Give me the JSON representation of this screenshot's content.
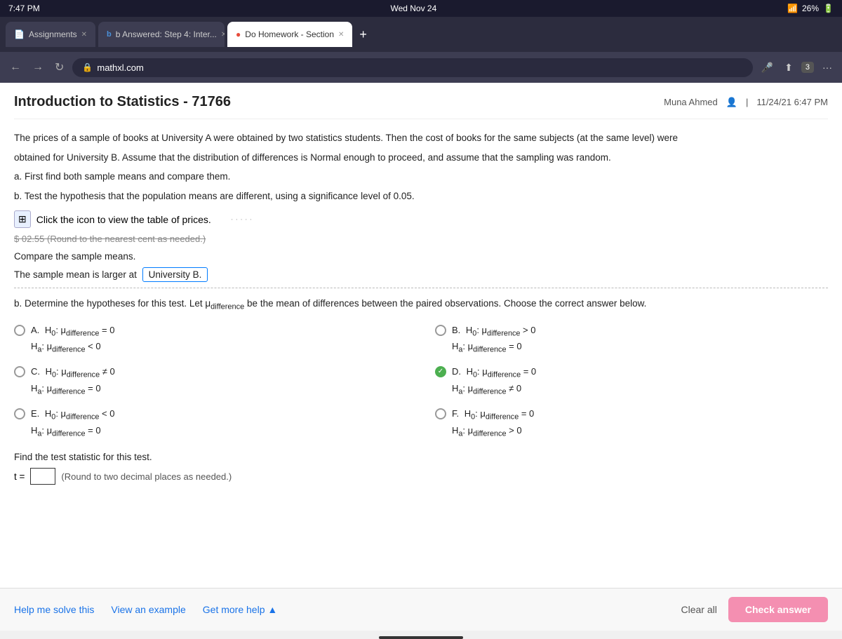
{
  "status_bar": {
    "time": "7:47 PM",
    "day": "Wed Nov 24",
    "battery": "26%",
    "wifi": "WiFi"
  },
  "browser": {
    "tabs": [
      {
        "id": "assignments",
        "label": "Assignments",
        "active": false,
        "icon": "doc"
      },
      {
        "id": "answered",
        "label": "b Answered: Step 4: Inter...",
        "active": false,
        "icon": "b"
      },
      {
        "id": "homework",
        "label": "Do Homework - Section",
        "active": true,
        "icon": "circle"
      }
    ],
    "url": "mathxl.com",
    "back": "←",
    "forward": "→",
    "refresh": "↻",
    "badge_count": "3"
  },
  "page": {
    "course_title": "Introduction to Statistics - 71766",
    "user": "Muna Ahmed",
    "date_time": "11/24/21 6:47 PM",
    "problem_text": [
      "The prices of a sample of books at University A were obtained by two statistics students. Then the cost of books for the same subjects (at the same level) were",
      "obtained for University B. Assume that the distribution of differences is Normal enough to proceed, and assume that the sampling was random.",
      "a. First find both sample means and compare them.",
      "b. Test the hypothesis that the population means are different, using a significance level of 0.05."
    ],
    "table_icon_label": "Click the icon to view the table of prices.",
    "strikethrough": "$ 02.55  (Round to the nearest cent as needed.)",
    "compare_label": "Compare the sample means.",
    "sample_mean_text": "The sample mean is larger at",
    "sample_mean_answer": "University B.",
    "hypothesis_intro": "b. Determine the hypotheses for this test. Let μ",
    "mu_subscript": "difference",
    "hypothesis_rest": "be the mean of differences between the paired observations. Choose the correct answer below.",
    "options": [
      {
        "id": "A",
        "h0": "H₀: μdifference = 0",
        "ha": "Hₐ: μdifference < 0",
        "selected": false
      },
      {
        "id": "B",
        "h0": "H₀: μdifference > 0",
        "ha": "Hₐ: μdifference = 0",
        "selected": false
      },
      {
        "id": "C",
        "h0": "H₀: μdifference ≠ 0",
        "ha": "Hₐ: μdifference = 0",
        "selected": false
      },
      {
        "id": "D",
        "h0": "H₀: μdifference = 0",
        "ha": "Hₐ: μdifference ≠ 0",
        "selected": true,
        "correct": true
      },
      {
        "id": "E",
        "h0": "H₀: μdifference < 0",
        "ha": "Hₐ: μdifference = 0",
        "selected": false
      },
      {
        "id": "F",
        "h0": "H₀: μdifference = 0",
        "ha": "Hₐ: μdifference > 0",
        "selected": false
      }
    ],
    "test_stat_label": "Find the test statistic for this test.",
    "test_stat_prefix": "t =",
    "test_stat_hint": "(Round to two decimal places as needed.)",
    "footer": {
      "help_btn": "Help me solve this",
      "example_btn": "View an example",
      "more_help_btn": "Get more help ▲",
      "clear_btn": "Clear all",
      "check_btn": "Check answer"
    }
  }
}
